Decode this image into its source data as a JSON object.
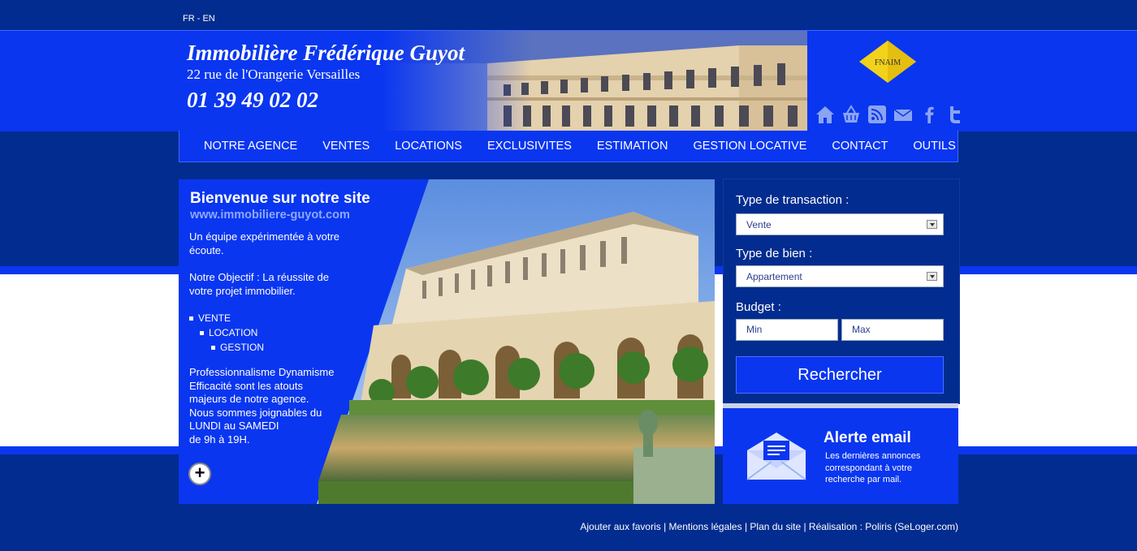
{
  "lang_switch": "FR - EN",
  "header": {
    "name": "Immobilière Frédérique Guyot",
    "address": "22 rue de l'Orangerie Versailles",
    "phone": "01 39 49 02 02",
    "fnaim_label": "FNAIM",
    "social_icons": [
      "home-icon",
      "basket-icon",
      "rss-icon",
      "mail-icon",
      "facebook-icon",
      "twitter-icon"
    ]
  },
  "nav": {
    "items": [
      "NOTRE AGENCE",
      "VENTES",
      "LOCATIONS",
      "EXCLUSIVITES",
      "ESTIMATION",
      "GESTION LOCATIVE",
      "CONTACT",
      "OUTILS"
    ]
  },
  "welcome": {
    "title": "Bienvenue sur notre site",
    "url": "www.immobiliere-guyot.com",
    "p1": "Un équipe expérimentée à votre écoute.",
    "p2": "Notre Objectif : La réussite de votre projet immobilier.",
    "list": [
      "VENTE",
      "LOCATION",
      "GESTION"
    ],
    "p3_lines": [
      "Professionnalisme Dynamisme",
      "Efficacité sont les atouts",
      "majeurs de notre agence.",
      "Nous sommes joignables du",
      "LUNDI au SAMEDI",
      "de 9h à 19H."
    ],
    "more_label": "+"
  },
  "search": {
    "transaction_label": "Type de transaction :",
    "transaction_value": "Vente",
    "bien_label": "Type de bien :",
    "bien_value": "Appartement",
    "budget_label": "Budget :",
    "min_placeholder": "Min",
    "max_placeholder": "Max",
    "submit_label": "Rechercher"
  },
  "alert": {
    "title": "Alerte email",
    "text": "Les dernières annonces correspondant à votre recherche par mail."
  },
  "footer": {
    "links": [
      "Ajouter aux favoris",
      "Mentions légales",
      "Plan du site",
      "Réalisation : Poliris (SeLoger.com)"
    ],
    "separator": " | "
  },
  "colors": {
    "dark_blue": "#022c8f",
    "bright_blue": "#0a36f0",
    "fnaim_yellow": "#f2d21a"
  }
}
